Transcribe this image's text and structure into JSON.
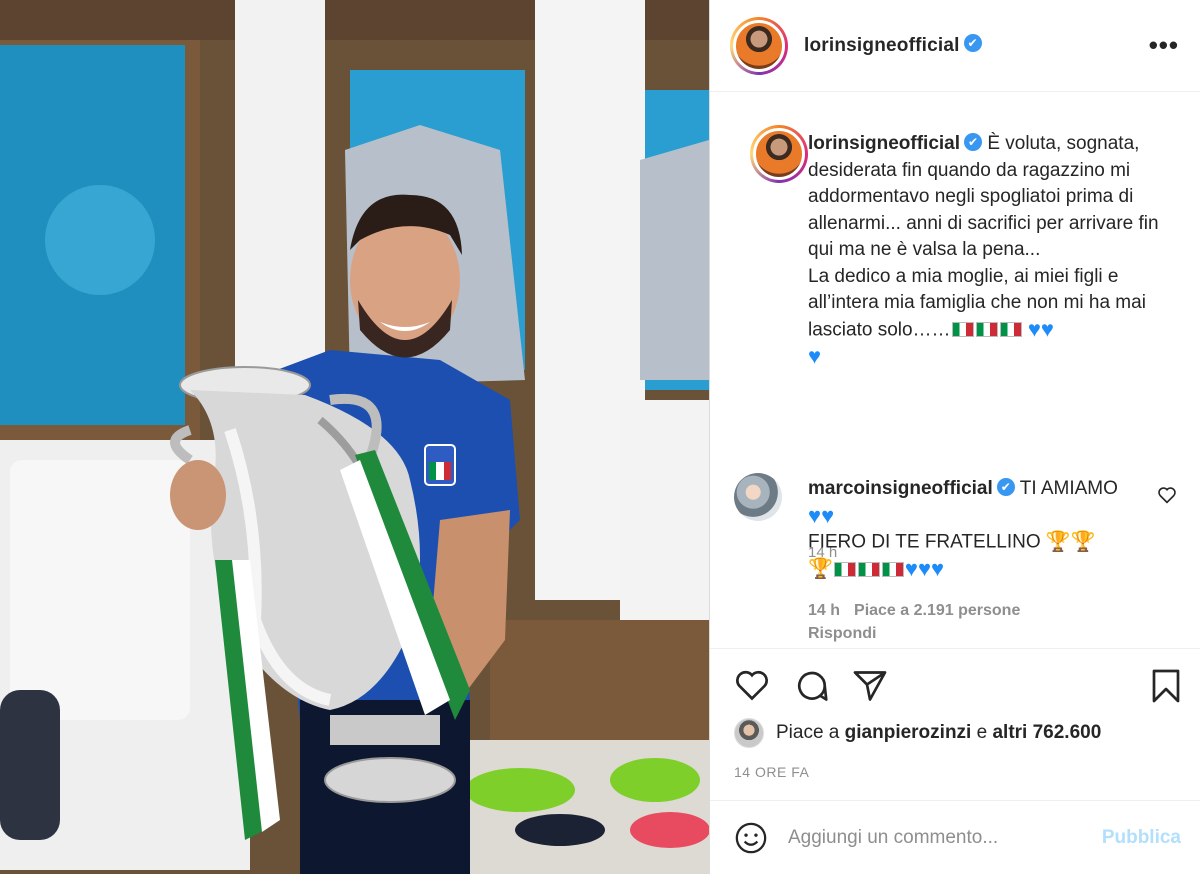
{
  "header": {
    "username": "lorinsigneofficial",
    "verified_mark": "✔",
    "more_label": "•••"
  },
  "caption": {
    "username": "lorinsigneofficial",
    "verified_mark": "✔",
    "text_1": "È voluta, sognata, desiderata fin quando da ragazzino mi addormentavo negli spogliatoi prima di allenarmi... anni di sacrifici per arrivare fin qui ma ne è valsa la pena...",
    "text_2": "La dedico a mia moglie, ai miei figli e all’intera mia famiglia che non mi ha mai lasciato solo……",
    "emoji_tail": "🇮🇹🇮🇹🇮🇹💙💙💙",
    "time": "14 h"
  },
  "comment": {
    "username": "marcoinsigneofficial",
    "verified_mark": "✔",
    "line_1": "TI AMIAMO",
    "line_2": "FIERO DI TE FRATELLINO",
    "time": "14 h",
    "likes": "Piace a 2.191 persone",
    "reply": "Rispondi"
  },
  "likes_row": {
    "prefix": "Piace a",
    "user": "gianpierozinzi",
    "conj": "e",
    "others": "altri 762.600"
  },
  "ago": "14 ORE FA",
  "add_comment": {
    "placeholder": "Aggiungi un commento...",
    "publish": "Pubblica"
  },
  "colors": {
    "link_blue": "#3897f0",
    "publish_disabled": "#b2dffc",
    "muted": "#8e8e8e"
  },
  "icons": [
    "heart-icon",
    "comment-icon",
    "share-icon",
    "bookmark-icon",
    "emoji-icon",
    "more-icon",
    "verified-icon"
  ]
}
